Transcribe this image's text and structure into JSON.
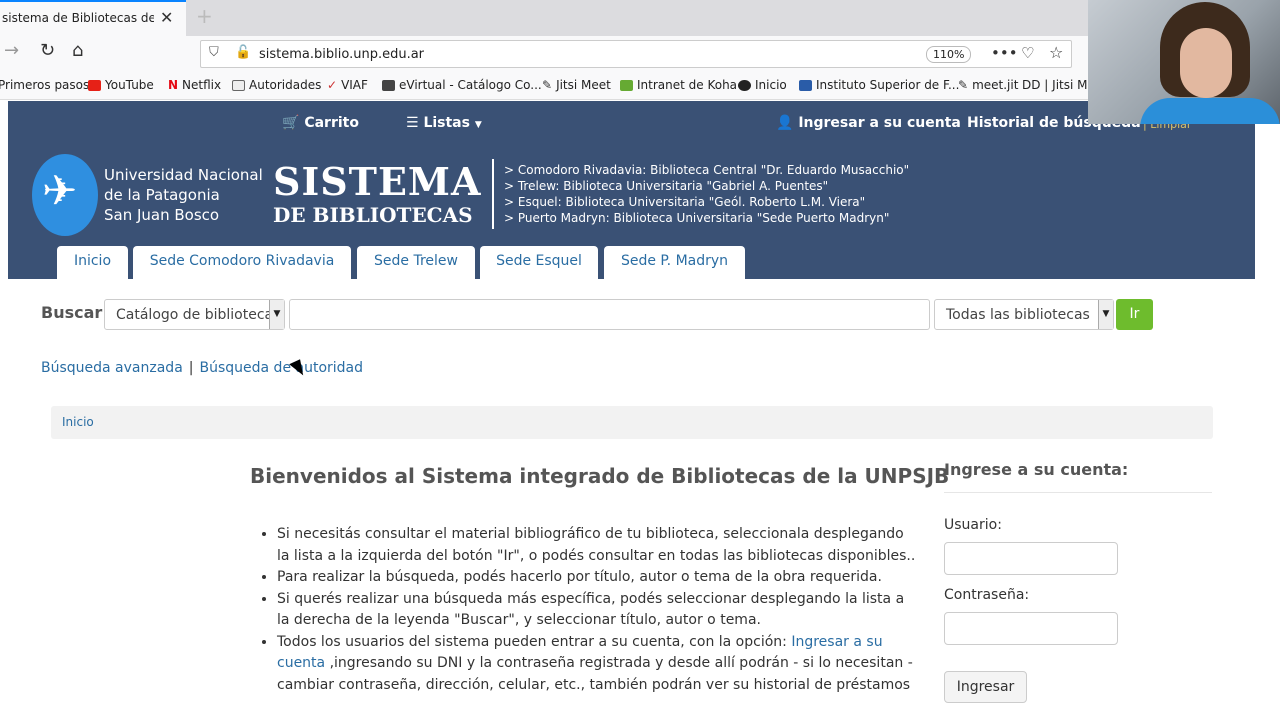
{
  "browser": {
    "tab_title": "sistema de Bibliotecas de la UN",
    "tab_close": "✕",
    "new_tab": "+",
    "url": "sistema.biblio.unp.edu.ar",
    "zoom": "110%",
    "bookmarks": [
      {
        "label": "Primeros pasos",
        "icon": "firefox-icon"
      },
      {
        "label": "YouTube",
        "icon": "youtube-icon"
      },
      {
        "label": "Netflix",
        "icon": "netflix-icon"
      },
      {
        "label": "Autoridades",
        "icon": "folder-icon"
      },
      {
        "label": "VIAF",
        "icon": "viaf-icon"
      },
      {
        "label": "eVirtual - Catálogo Co...",
        "icon": "evirtual-icon"
      },
      {
        "label": "Jitsi Meet",
        "icon": "jitsi-icon"
      },
      {
        "label": "Intranet de Koha",
        "icon": "koha-icon"
      },
      {
        "label": "Inicio",
        "icon": "inicio-icon"
      },
      {
        "label": "Instituto Superior de F...",
        "icon": "instituto-icon"
      },
      {
        "label": "meet.jit",
        "icon": "jitsi-icon"
      },
      {
        "label": "DD | Jitsi Meet",
        "icon": "page-icon"
      }
    ]
  },
  "header": {
    "carrito": "Carrito",
    "listas": "Listas",
    "ingresar": "Ingresar a su cuenta",
    "historial": "Historial de búsqueda",
    "limpiar": "Limpiar",
    "uni_lines": [
      "Universidad Nacional",
      "de la Patagonia",
      "San Juan Bosco"
    ],
    "sistema": "SISTEMA",
    "de_bibliotecas": "DE BIBLIOTECAS",
    "sedes": [
      "> Comodoro Rivadavia: Biblioteca Central \"Dr. Eduardo Musacchio\"",
      "> Trelew: Biblioteca Universitaria \"Gabriel A. Puentes\"",
      "> Esquel: Biblioteca Universitaria \"Geól. Roberto L.M. Viera\"",
      "> Puerto Madryn: Biblioteca Universitaria \"Sede Puerto Madryn\""
    ],
    "tabs": [
      "Inicio",
      "Sede Comodoro Rivadavia",
      "Sede Trelew",
      "Sede Esquel",
      "Sede P. Madryn"
    ]
  },
  "search": {
    "label": "Buscar",
    "catalog_select": "Catálogo de biblioteca",
    "library_select": "Todas las bibliotecas",
    "go": "Ir",
    "advanced": "Búsqueda avanzada",
    "separator": "|",
    "authority": "Búsqueda de autoridad"
  },
  "breadcrumb": "Inicio",
  "main": {
    "welcome": "Bienvenidos al Sistema integrado de Bibliotecas de la UNPSJB",
    "tip1": "Si necesitás consultar el material bibliográfico de tu biblioteca, seleccionala desplegando la lista a la izquierda del botón \"Ir\", o podés consultar en todas las bibliotecas disponibles..",
    "tip2": "Para realizar la búsqueda, podés hacerlo por título, autor o tema de la obra requerida.",
    "tip3": "Si querés realizar una búsqueda más específica, podés seleccionar desplegando la lista a la derecha de la leyenda \"Buscar\", y seleccionar título, autor o tema.",
    "tip4_pre": "Todos los usuarios del sistema pueden entrar a su cuenta, con la opción: ",
    "tip4_link": "Ingresar a su cuenta",
    "tip4_post": " ,ingresando su DNI y la contraseña registrada y desde allí podrán - si lo necesitan - cambiar contraseña, dirección, celular, etc., también podrán ver su historial de préstamos"
  },
  "login": {
    "title": "Ingrese a su cuenta:",
    "usuario": "Usuario:",
    "password": "Contraseña:",
    "button": "Ingresar"
  }
}
